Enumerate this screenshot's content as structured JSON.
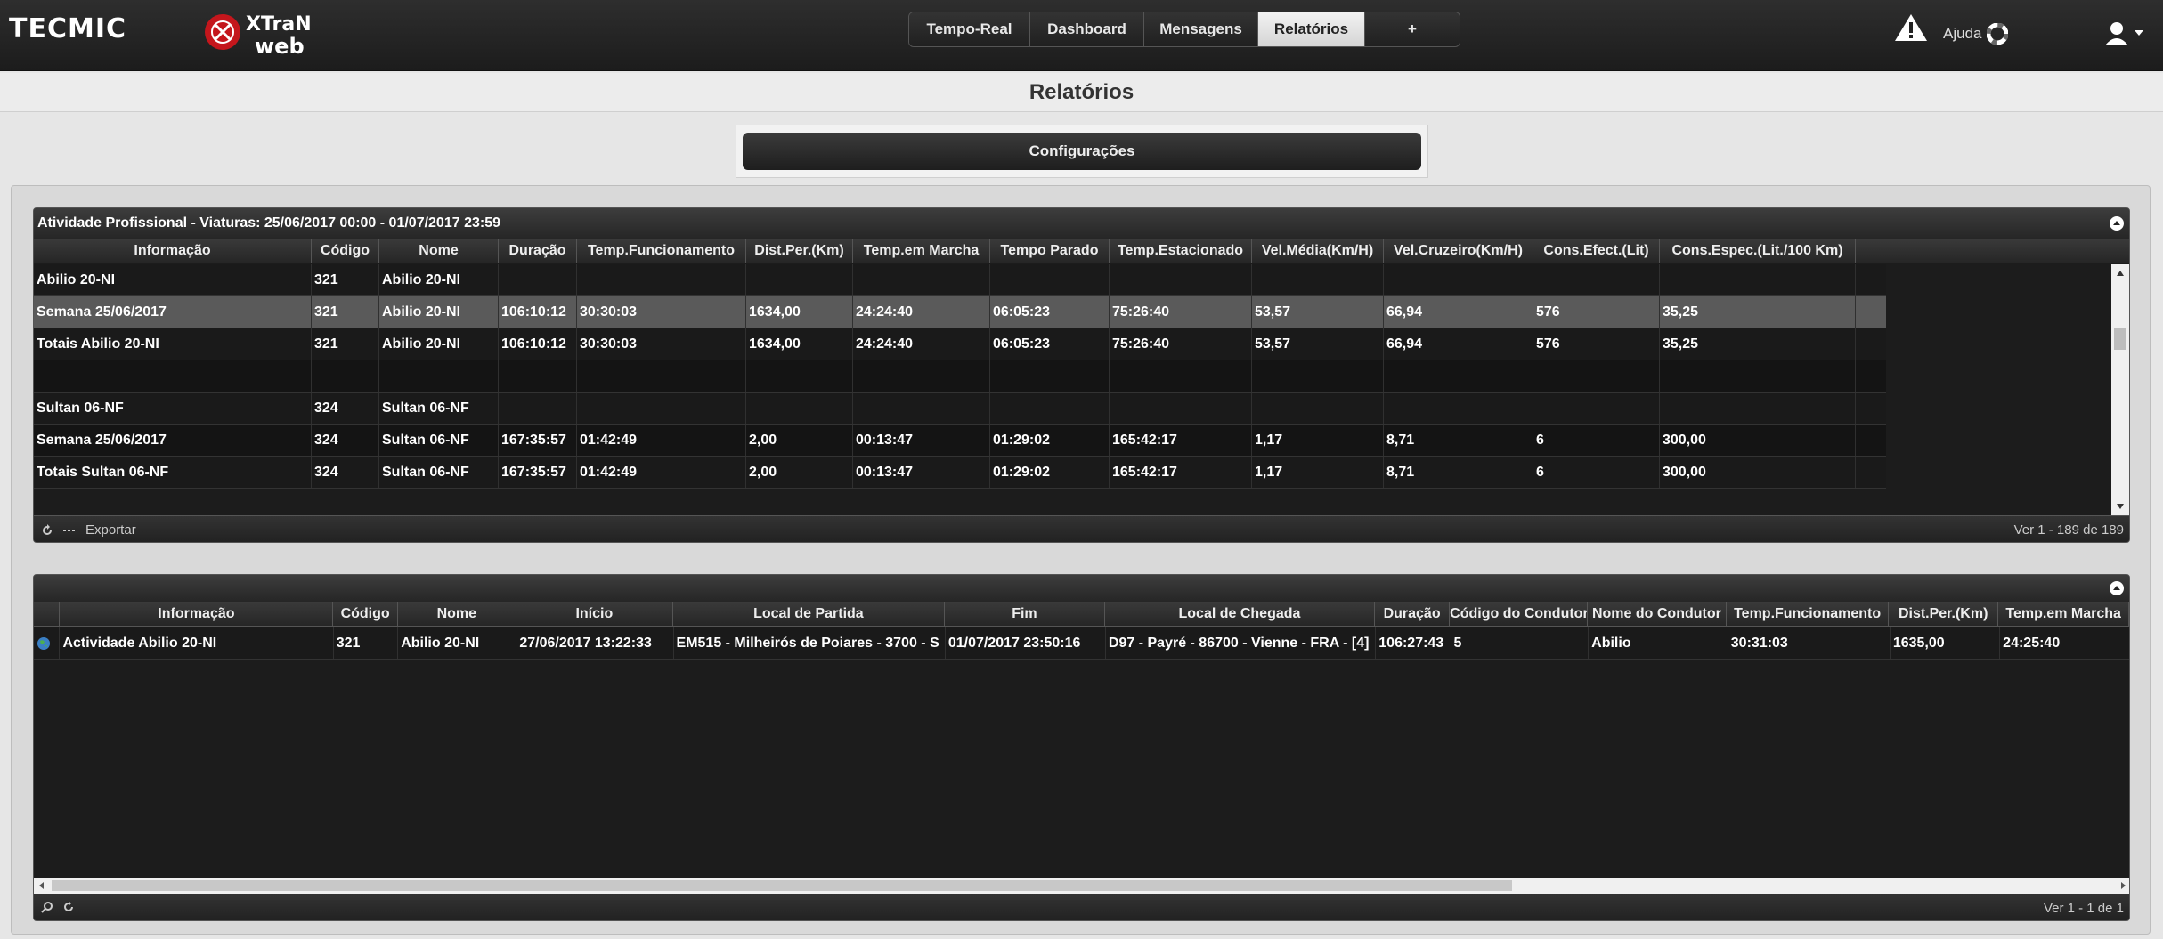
{
  "brand": {
    "tecmic": "TECMIC",
    "xtran_line1": "XTraN",
    "xtran_line2": "web"
  },
  "nav": {
    "tabs": [
      {
        "label": "Tempo-Real"
      },
      {
        "label": "Dashboard"
      },
      {
        "label": "Mensagens"
      },
      {
        "label": "Relatórios"
      },
      {
        "label": "+"
      }
    ],
    "active": "Relatórios"
  },
  "header": {
    "help_label": "Ajuda"
  },
  "page": {
    "title": "Relatórios",
    "config_button": "Configurações"
  },
  "report1": {
    "caption": "Atividade Profissional - Viaturas: 25/06/2017 00:00 - 01/07/2017 23:59",
    "columns": [
      "Informação",
      "Código",
      "Nome",
      "Duração",
      "Temp.Funcionamento",
      "Dist.Per.(Km)",
      "Temp.em Marcha",
      "Tempo Parado",
      "Temp.Estacionado",
      "Vel.Média(Km/H)",
      "Vel.Cruzeiro(Km/H)",
      "Cons.Efect.(Lit)",
      "Cons.Espec.(Lit./100 Km)"
    ],
    "rows": [
      [
        "Abilio 20-NI",
        "321",
        "Abilio 20-NI",
        "",
        "",
        "",
        "",
        "",
        "",
        "",
        "",
        "",
        ""
      ],
      [
        "Semana 25/06/2017",
        "321",
        "Abilio 20-NI",
        "106:10:12",
        "30:30:03",
        "1634,00",
        "24:24:40",
        "06:05:23",
        "75:26:40",
        "53,57",
        "66,94",
        "576",
        "35,25"
      ],
      [
        "Totais Abilio 20-NI",
        "321",
        "Abilio 20-NI",
        "106:10:12",
        "30:30:03",
        "1634,00",
        "24:24:40",
        "06:05:23",
        "75:26:40",
        "53,57",
        "66,94",
        "576",
        "35,25"
      ],
      [
        "",
        "",
        "",
        "",
        "",
        "",
        "",
        "",
        "",
        "",
        "",
        "",
        ""
      ],
      [
        "Sultan 06-NF",
        "324",
        "Sultan 06-NF",
        "",
        "",
        "",
        "",
        "",
        "",
        "",
        "",
        "",
        ""
      ],
      [
        "Semana 25/06/2017",
        "324",
        "Sultan 06-NF",
        "167:35:57",
        "01:42:49",
        "2,00",
        "00:13:47",
        "01:29:02",
        "165:42:17",
        "1,17",
        "8,71",
        "6",
        "300,00"
      ],
      [
        "Totais Sultan 06-NF",
        "324",
        "Sultan 06-NF",
        "167:35:57",
        "01:42:49",
        "2,00",
        "00:13:47",
        "01:29:02",
        "165:42:17",
        "1,17",
        "8,71",
        "6",
        "300,00"
      ]
    ],
    "selected_row": 1,
    "export_label": "Exportar",
    "pager_text": "Ver 1 - 189 de 189"
  },
  "report2": {
    "columns": [
      "Informação",
      "Código",
      "Nome",
      "Início",
      "Local de Partida",
      "Fim",
      "Local de Chegada",
      "Duração",
      "Código do Condutor",
      "Nome do Condutor",
      "Temp.Funcionamento",
      "Dist.Per.(Km)",
      "Temp.em Marcha"
    ],
    "rows": [
      [
        "Actividade Abilio 20-NI",
        "321",
        "Abilio 20-NI",
        "27/06/2017 13:22:33",
        "EM515 - Milheirós de Poiares - 3700 - S",
        "01/07/2017 23:50:16",
        "D97 - Payré - 86700 - Vienne - FRA - [4]",
        "106:27:43",
        "5",
        "Abilio",
        "30:31:03",
        "1635,00",
        "24:25:40"
      ]
    ],
    "pager_text": "Ver 1 - 1 de 1"
  }
}
